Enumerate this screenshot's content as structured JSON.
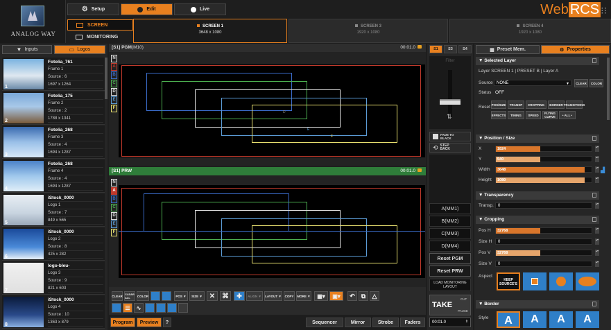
{
  "app": {
    "brand_web": "Web",
    "brand_rcs": "RCS",
    "logo_text": "ANALOG WAY"
  },
  "modes": {
    "setup": "Setup",
    "edit": "Edit",
    "live": "Live"
  },
  "screen_menu": {
    "screen": "SCREEN",
    "monitoring": "MONITORING"
  },
  "screens": [
    {
      "name": "SCREEN 1",
      "res": "3648 x 1080"
    },
    {
      "name": "SCREEN 3",
      "res": "1920 x 1080"
    },
    {
      "name": "SCREEN 4",
      "res": "1920 x 1080"
    }
  ],
  "left_tabs": {
    "inputs": "Inputs",
    "logos": "Logos"
  },
  "sources": [
    {
      "title": "Fotolia_761",
      "frame": "Frame 1",
      "source": "Source : 6",
      "size": "1697 x 1264",
      "num": "1"
    },
    {
      "title": "Fotolia_175",
      "frame": "Frame 2",
      "source": "Source : 2",
      "size": "1788 x 1341",
      "num": "2"
    },
    {
      "title": "Fotolia_268",
      "frame": "Frame 3",
      "source": "Source : 4",
      "size": "1694 x 1287",
      "num": "3"
    },
    {
      "title": "Fotolia_268",
      "frame": "Frame 4",
      "source": "Source : 4",
      "size": "1694 x 1287",
      "num": "4"
    },
    {
      "title": "iStock_0000",
      "frame": "Logo 1",
      "source": "Source : 7",
      "size": "849 x 565",
      "num": "5"
    },
    {
      "title": "iStock_0000",
      "frame": "Logo 2",
      "source": "Source : 8",
      "size": "425 x 282",
      "num": "6"
    },
    {
      "title": "logo-bleu-",
      "frame": "Logo 3",
      "source": "Source : 9",
      "size": "821 x 603",
      "num": "7"
    },
    {
      "title": "iStock_0000",
      "frame": "Logo 4",
      "source": "Source : 10",
      "size": "1363 x 879",
      "num": "8"
    }
  ],
  "pgm": {
    "title": "[S1] PGM",
    "sub": "(M10)",
    "time": "00:01.0"
  },
  "prw": {
    "title": "[S1] PRW",
    "time": "00:01.0"
  },
  "layer_buttons": [
    "N",
    "A",
    "B",
    "C",
    "D",
    "E",
    "F"
  ],
  "toolbar": {
    "clear": "CLEAR",
    "clear_all": "CLEAR ALL",
    "color": "COLOR",
    "pos": "POS ▼",
    "size": "SIZE ▼",
    "align": "ALIGN ▼",
    "layout": "LAYOUT ▼",
    "copy": "COPY",
    "more": "MORE ▼"
  },
  "bottom": {
    "program": "Program",
    "preview": "Preview",
    "help": "?",
    "sequencer": "Sequencer",
    "mirror": "Mirror",
    "strobe": "Strobe",
    "faders": "Faders"
  },
  "mid": {
    "tabs": [
      "S1",
      "S3",
      "S4"
    ],
    "filter": "Filter",
    "fade_to_black": "FADE TO BLACK",
    "step_back": "STEP BACK",
    "mm": [
      "A(MM1)",
      "B(MM2)",
      "C(MM3)",
      "D(MM4)"
    ],
    "reset_pgm": "Reset PGM",
    "reset_prw": "Reset PRW",
    "load_monitoring": "LOAD MONITORING LAYOUT",
    "take": "TAKE",
    "cut": "CUT",
    "pause": "PAUSE",
    "time": "00:01.0"
  },
  "right": {
    "preset_mem": "Preset Mem.",
    "properties": "Properties",
    "selected_layer": "▼ Selected Layer",
    "layer_line": "Layer   SCREEN 1  |  PRESET B  |  Layer A",
    "source_label": "Source",
    "source_value": "NONE",
    "clear": "CLEAR",
    "color": "COLOR",
    "status_label": "Status",
    "status_value": "OFF",
    "reset_label": "Reset",
    "reset_btns": [
      "POS/SIZE",
      "TRANSP",
      "CROPPING",
      "BORDER",
      "TRANSITIONS",
      "EFFECTS",
      "TIMING",
      "SPEED",
      "FLYING CURVE",
      "• ALL •"
    ],
    "pos_size": "▼ Position / Size",
    "x_label": "X",
    "x_val": "1824",
    "y_label": "Y",
    "y_val": "540",
    "w_label": "Width",
    "w_val": "3648",
    "h_label": "Height",
    "h_val": "1080",
    "transparency": "▼ Transparency",
    "transp_label": "Transp.",
    "transp_val": "0",
    "cropping": "▼ Cropping",
    "posh_label": "Pos H",
    "posh_val": "32768",
    "sizeh_label": "Size H",
    "sizeh_val": "0",
    "posv_label": "Pos V",
    "posv_val": "32768",
    "sizev_label": "Size V",
    "sizev_val": "0",
    "aspect_label": "Aspect",
    "keep_source": "KEEP SOURCE'S",
    "border": "▼ Border",
    "style_label": "Style",
    "style_letter": "A"
  },
  "colors": {
    "accent": "#e8801f",
    "green": "#2f7d3a",
    "blue": "#2f7fc8"
  }
}
